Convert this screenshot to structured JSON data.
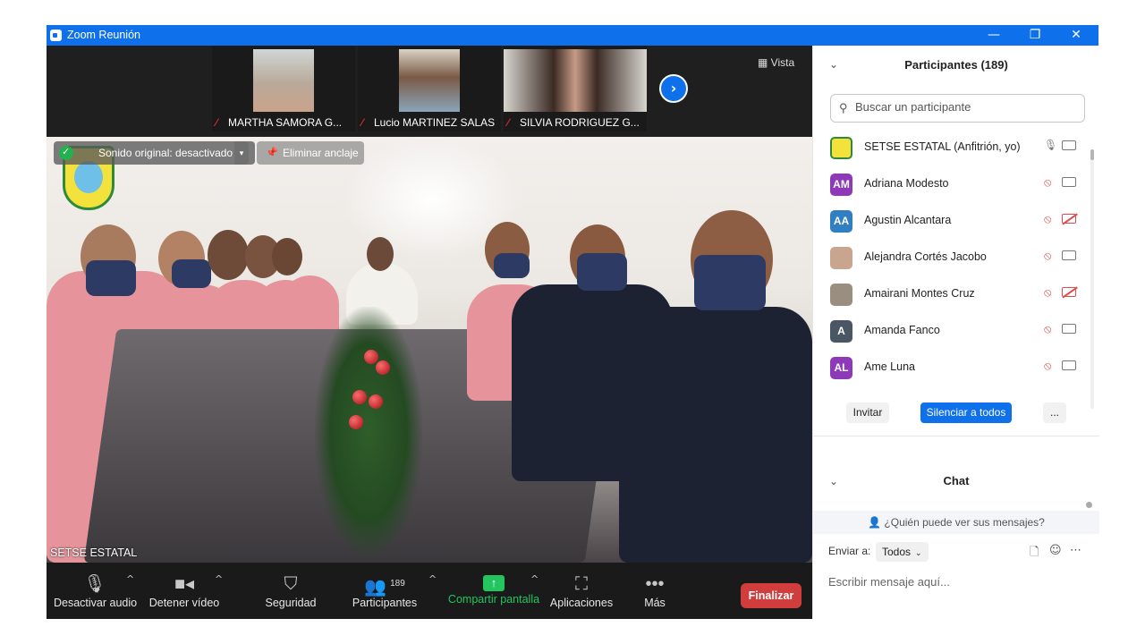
{
  "window": {
    "title": "Zoom Reunión",
    "minimize": "—",
    "restore": "❐",
    "close": "✕"
  },
  "filmstrip": {
    "participants": [
      {
        "name": "MARTHA SAMORA G..."
      },
      {
        "name": "Lucio MARTINEZ SALAS"
      },
      {
        "name": "SILVIA RODRIGUEZ G..."
      }
    ],
    "next_icon": "›",
    "view_label": "Vista"
  },
  "main_video": {
    "original_sound_label": "Sonido original: desactivado",
    "unpin_label": "Eliminar anclaje",
    "speaker_name": "SETSE ESTATAL"
  },
  "toolbar": {
    "mute_label": "Desactivar audio",
    "video_label": "Detener vídeo",
    "security_label": "Seguridad",
    "participants_label": "Participantes",
    "participants_count": "189",
    "share_label": "Compartir pantalla",
    "apps_label": "Aplicaciones",
    "more_label": "Más",
    "end_label": "Finalizar",
    "colors": {
      "share": "#22c55e",
      "end": "#d13d3d"
    }
  },
  "participants_panel": {
    "title": "Participantes (189)",
    "search_placeholder": "Buscar un participante",
    "list": [
      {
        "name": "SETSE ESTATAL (Anfitrión, yo)",
        "initials": "",
        "avatar_color": "#f4e23c",
        "mic_muted": false,
        "video_off": false
      },
      {
        "name": "Adriana Modesto",
        "initials": "AM",
        "avatar_color": "#8e3ab8",
        "mic_muted": true,
        "video_off": false
      },
      {
        "name": "Agustin Alcantara",
        "initials": "AA",
        "avatar_color": "#2f7fc2",
        "mic_muted": true,
        "video_off": true
      },
      {
        "name": "Alejandra Cortés Jacobo",
        "initials": "",
        "avatar_color": "#c9a48f",
        "mic_muted": true,
        "video_off": false
      },
      {
        "name": "Amairani Montes Cruz",
        "initials": "",
        "avatar_color": "#9a8e80",
        "mic_muted": true,
        "video_off": true
      },
      {
        "name": "Amanda Fanco",
        "initials": "A",
        "avatar_color": "#4a5663",
        "mic_muted": true,
        "video_off": false
      },
      {
        "name": "Ame Luna",
        "initials": "AL",
        "avatar_color": "#8e3ab8",
        "mic_muted": true,
        "video_off": false
      }
    ],
    "invite_label": "Invitar",
    "mute_all_label": "Silenciar a todos",
    "more_label": "...",
    "colors": {
      "mute_all": "#0e71eb"
    }
  },
  "chat": {
    "title": "Chat",
    "who_can_see": "¿Quién puede ver sus mensajes?",
    "send_to_label": "Enviar a:",
    "recipient": "Todos",
    "input_placeholder": "Escribir mensaje aquí..."
  }
}
